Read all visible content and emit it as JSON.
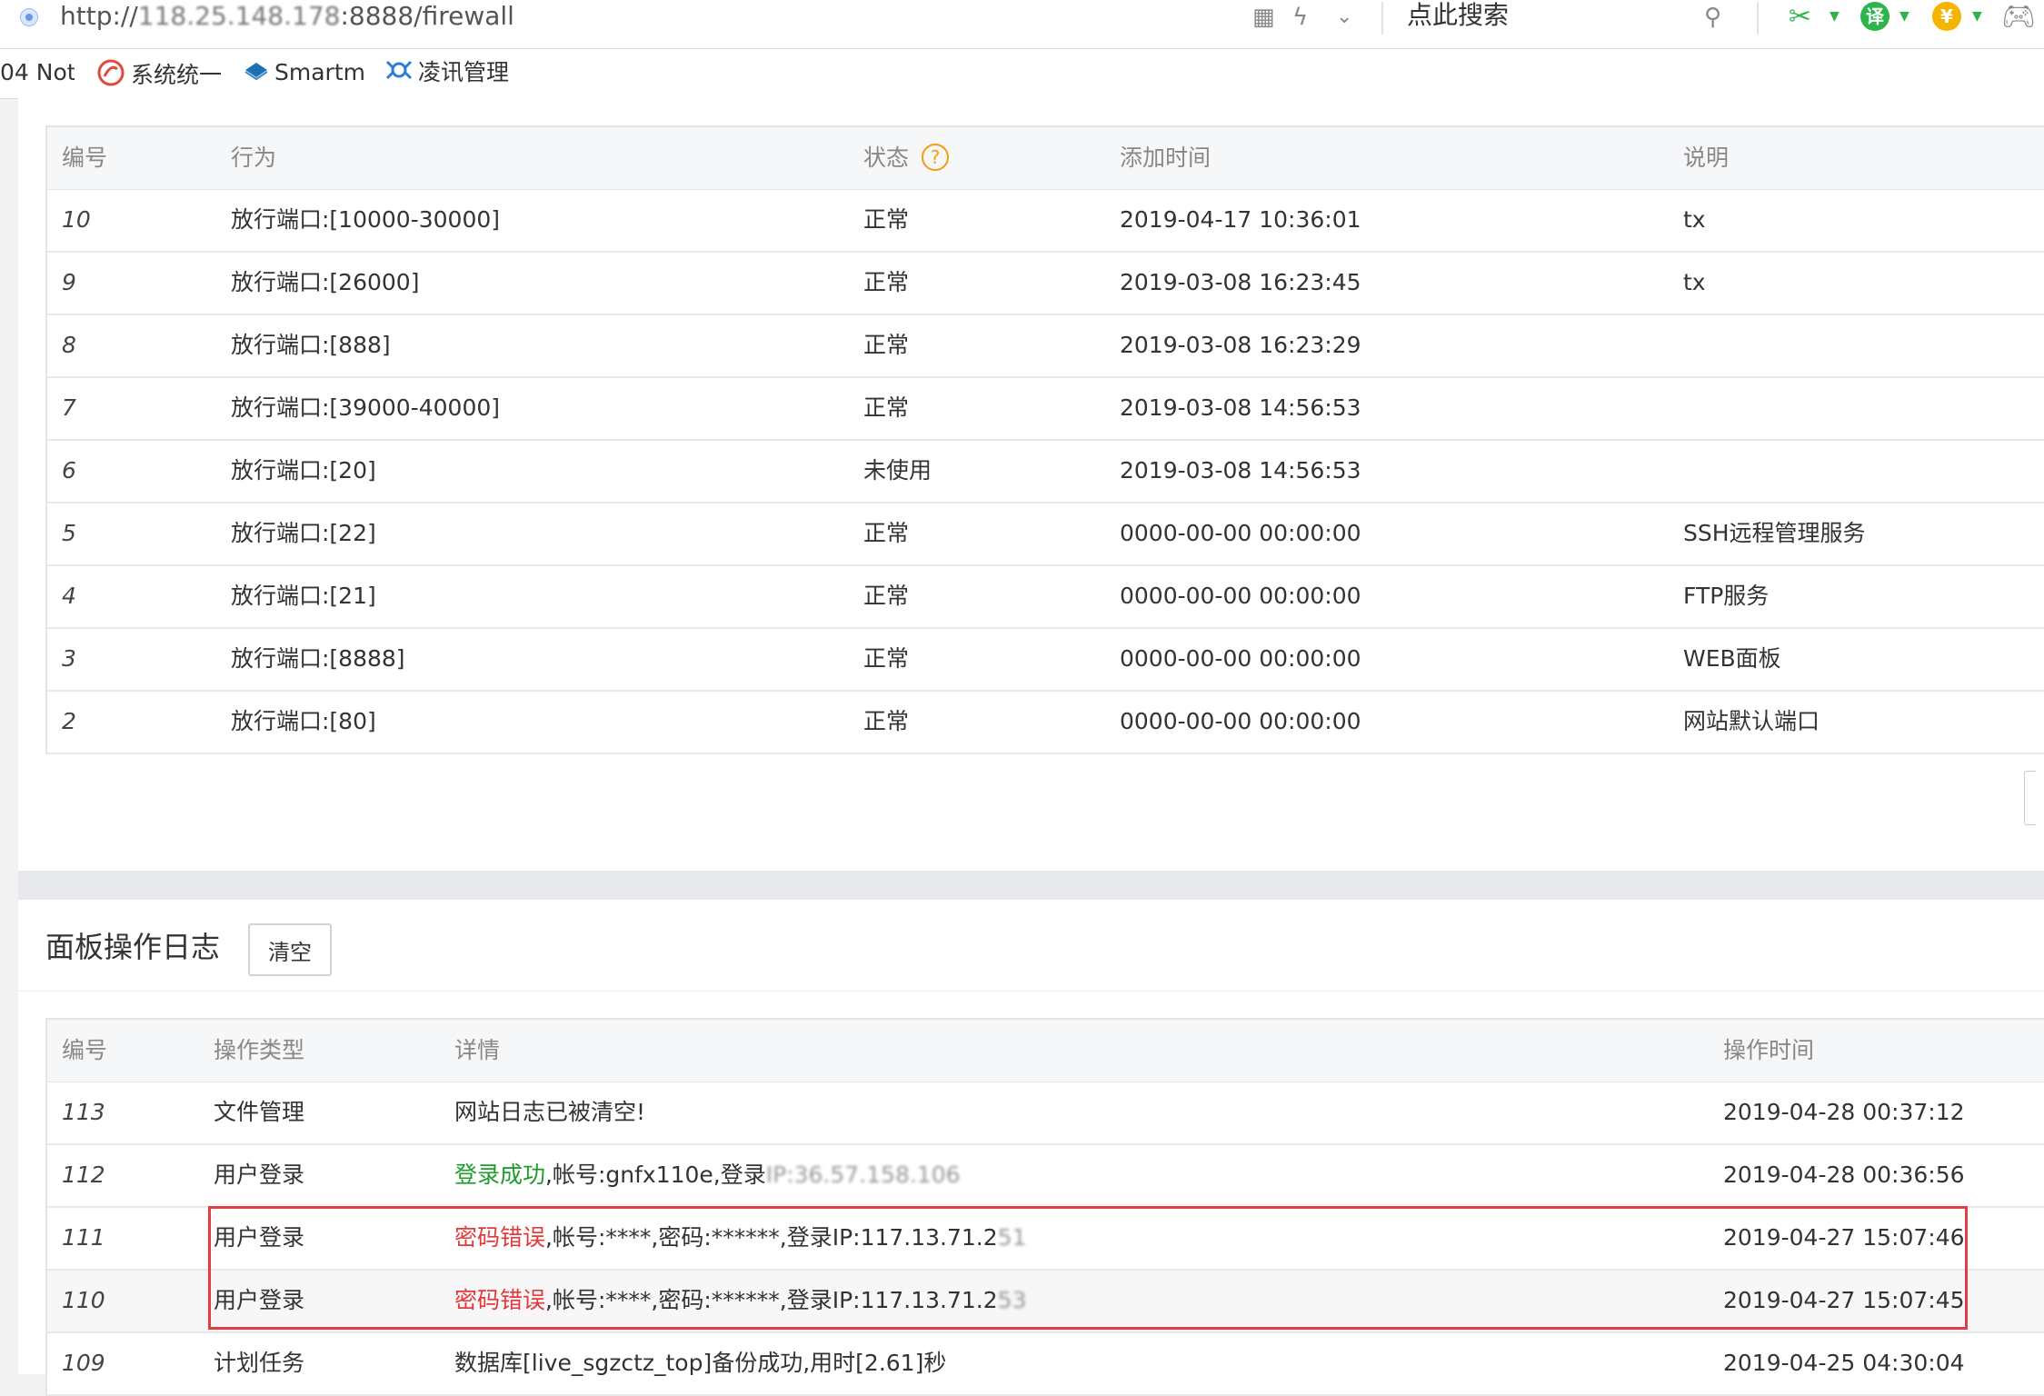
{
  "browser": {
    "url_prefix": "http://",
    "url_host_masked": "118.25.148.178",
    "url_suffix": ":8888/firewall",
    "search_placeholder": "点此搜索",
    "ext_translate": "译",
    "ext_yuan": "¥"
  },
  "bookmarks": [
    {
      "label": "04 Not"
    },
    {
      "label": "系统统一"
    },
    {
      "label": "Smartm"
    },
    {
      "label": "凌讯管理"
    }
  ],
  "firewall": {
    "columns": {
      "id": "编号",
      "action": "行为",
      "status": "状态",
      "status_help": "?",
      "time": "添加时间",
      "note": "说明"
    },
    "rows": [
      {
        "id": "10",
        "action": "放行端口:[10000-30000]",
        "status": "正常",
        "time": "2019-04-17 10:36:01",
        "note": "tx"
      },
      {
        "id": "9",
        "action": "放行端口:[26000]",
        "status": "正常",
        "time": "2019-03-08 16:23:45",
        "note": "tx"
      },
      {
        "id": "8",
        "action": "放行端口:[888]",
        "status": "正常",
        "time": "2019-03-08 16:23:29",
        "note": ""
      },
      {
        "id": "7",
        "action": "放行端口:[39000-40000]",
        "status": "正常",
        "time": "2019-03-08 14:56:53",
        "note": ""
      },
      {
        "id": "6",
        "action": "放行端口:[20]",
        "status": "未使用",
        "time": "2019-03-08 14:56:53",
        "note": ""
      },
      {
        "id": "5",
        "action": "放行端口:[22]",
        "status": "正常",
        "time": "0000-00-00 00:00:00",
        "note": "SSH远程管理服务"
      },
      {
        "id": "4",
        "action": "放行端口:[21]",
        "status": "正常",
        "time": "0000-00-00 00:00:00",
        "note": "FTP服务"
      },
      {
        "id": "3",
        "action": "放行端口:[8888]",
        "status": "正常",
        "time": "0000-00-00 00:00:00",
        "note": "WEB面板"
      },
      {
        "id": "2",
        "action": "放行端口:[80]",
        "status": "正常",
        "time": "0000-00-00 00:00:00",
        "note": "网站默认端口"
      }
    ]
  },
  "log": {
    "title": "面板操作日志",
    "clear_label": "清空",
    "columns": {
      "id": "编号",
      "type": "操作类型",
      "detail": "详情",
      "time": "操作时间"
    },
    "rows": [
      {
        "id": "113",
        "type": "文件管理",
        "detail_plain": "网站日志已被清空!",
        "time": "2019-04-28 00:37:12"
      },
      {
        "id": "112",
        "type": "用户登录",
        "detail_status": "登录成功",
        "detail_rest": ",帐号:gnfx110e,登录",
        "detail_masked": "IP:36.57.158.106",
        "time": "2019-04-28 00:36:56"
      },
      {
        "id": "111",
        "type": "用户登录",
        "detail_status": "密码错误",
        "detail_rest": ",帐号:****,密码:******,登录IP:117.13.71.2",
        "detail_masked": "51",
        "time": "2019-04-27 15:07:46"
      },
      {
        "id": "110",
        "type": "用户登录",
        "detail_status": "密码错误",
        "detail_rest": ",帐号:****,密码:******,登录IP:117.13.71.2",
        "detail_masked": "53",
        "time": "2019-04-27 15:07:45"
      },
      {
        "id": "109",
        "type": "计划任务",
        "detail_plain": "数据库[live_sgzctz_top]备份成功,用时[2.61]秒",
        "time": "2019-04-25 04:30:04"
      }
    ]
  },
  "colors": {
    "success": "#1f9d2a",
    "error": "#e5383b",
    "highlight_box": "#e43c43",
    "help_icon": "#f39c12"
  }
}
